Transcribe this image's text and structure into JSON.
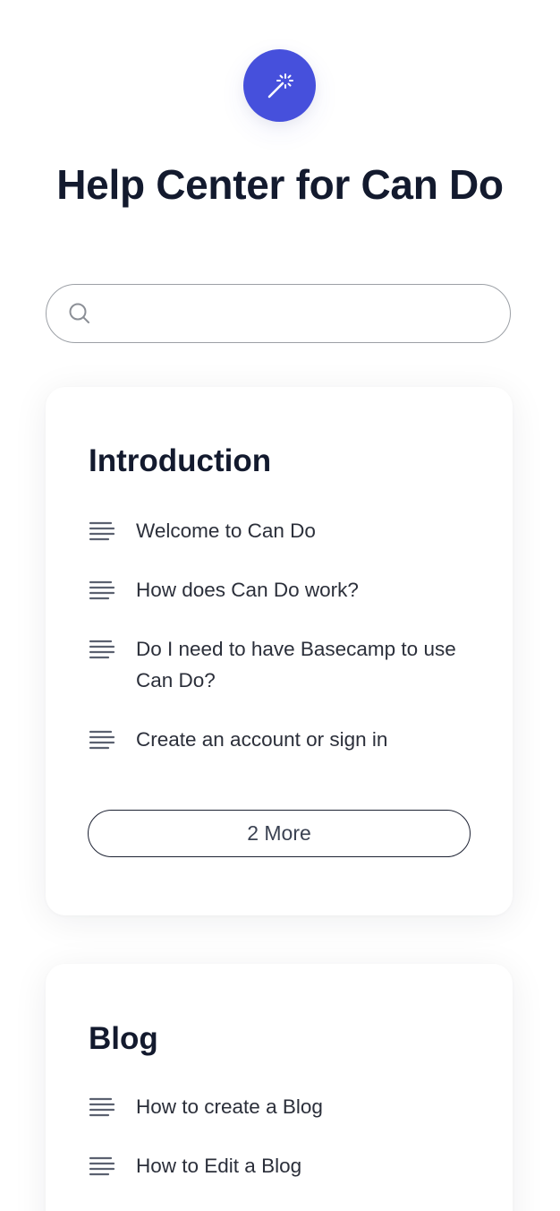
{
  "header": {
    "logo_icon": "magic-wand-icon",
    "accent_color": "#4650dc",
    "title": "Help Center for Can Do"
  },
  "search": {
    "icon": "search-icon",
    "value": "",
    "placeholder": ""
  },
  "categories": [
    {
      "title": "Introduction",
      "articles": [
        {
          "label": "Welcome to Can Do",
          "icon": "document-lines-icon"
        },
        {
          "label": "How does Can Do work?",
          "icon": "document-lines-icon"
        },
        {
          "label": "Do I need to have Basecamp to use Can Do?",
          "icon": "document-lines-icon"
        },
        {
          "label": "Create an account or sign in",
          "icon": "document-lines-icon"
        }
      ],
      "more_label": "2 More"
    },
    {
      "title": "Blog",
      "articles": [
        {
          "label": "How to create a Blog",
          "icon": "document-lines-icon"
        },
        {
          "label": "How to Edit a Blog",
          "icon": "document-lines-icon"
        }
      ]
    }
  ]
}
